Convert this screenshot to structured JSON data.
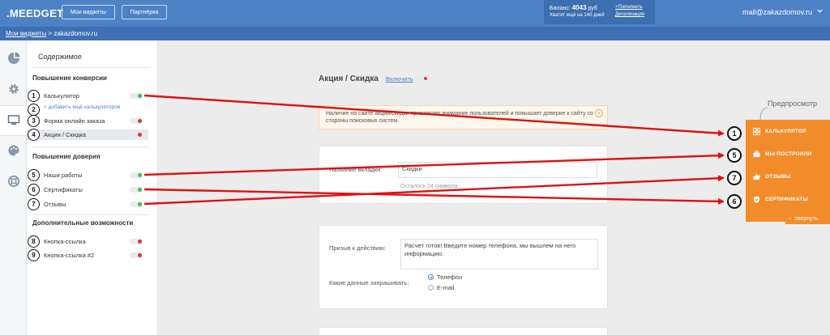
{
  "header": {
    "logo": ".MEEDGET",
    "btn_widgets": "Мои виджеты",
    "btn_partner": "Партнёрка",
    "balance_label": "Баланс:",
    "balance_value": "4043",
    "balance_unit": "руб",
    "balance_days": "Хватит ещё на 140 дней",
    "link_topup": "+Пополнить",
    "link_details": "Детализация",
    "email": "mail@zakazdomov.ru"
  },
  "breadcrumb": {
    "root": "Мои виджеты",
    "sep": ">",
    "current": "zakazdomov.ru"
  },
  "sidebar": {
    "title": "Содержимое",
    "sections": [
      {
        "title": "Повышение конверсии",
        "items": [
          {
            "n": "1",
            "label": "Калькулятор",
            "on": true
          },
          {
            "n": "3",
            "label": "Форма онлайн заказа",
            "on": false
          },
          {
            "n": "4",
            "label": "Акция / Скидка",
            "on": false
          }
        ],
        "add_link_n": "2",
        "add_link": "+ добавить ещё калькуляторов"
      },
      {
        "title": "Повышение доверия",
        "items": [
          {
            "n": "5",
            "label": "Наши работы",
            "on": true
          },
          {
            "n": "6",
            "label": "Сертификаты",
            "on": true
          },
          {
            "n": "7",
            "label": "Отзывы",
            "on": true
          }
        ]
      },
      {
        "title": "Дополнительные возможности",
        "items": [
          {
            "n": "8",
            "label": "Кнопка-ссылка",
            "on": false
          },
          {
            "n": "9",
            "label": "Кнопка-ссылка #2",
            "on": false
          }
        ]
      }
    ]
  },
  "main": {
    "title": "Акция / Скидка",
    "enable_link": "Включить",
    "notice": "Наличие на сайте акции/скидки привлекает внимание пользователей и повышает доверие к сайту со стороны поисковых систем.",
    "tab_name_label": "Название вкладки:",
    "tab_name_value": "Скидки",
    "chars_left": "Осталось 24 символа",
    "cta_label": "Призыв к действию:",
    "cta_value": "Расчёт готов! Введите номер телефона, мы вышлем на него информацию.",
    "data_label": "Какие данные запрашивать:",
    "radio_phone": "Телефон",
    "radio_email": "E-mail"
  },
  "preview": {
    "label": "Предпросмотр",
    "items": [
      {
        "n": "1",
        "label": "КАЛЬКУЛЯТОР",
        "icon": "grid-icon"
      },
      {
        "n": "5",
        "label": "МЫ ПОСТРОИЛИ",
        "icon": "briefcase-icon"
      },
      {
        "n": "7",
        "label": "ОТЗЫВЫ",
        "icon": "thumbs-up-icon"
      },
      {
        "n": "6",
        "label": "СЕРТИФИКАТЫ",
        "icon": "badge-icon"
      }
    ],
    "collapse": "свернуть"
  },
  "colors": {
    "header": "#4d82c6",
    "accent": "#f28c2b",
    "arrow": "#e01010",
    "on": "#37c34a",
    "off": "#e23535"
  }
}
